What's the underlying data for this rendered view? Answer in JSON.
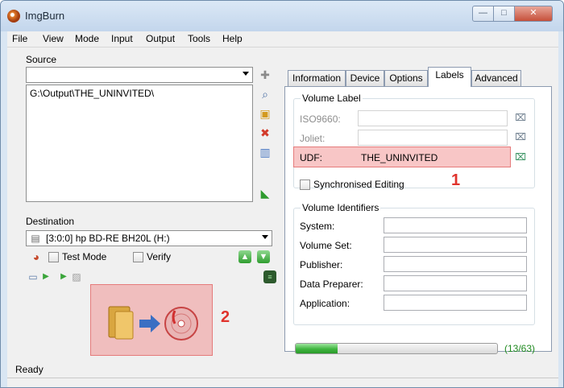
{
  "window": {
    "title": "ImgBurn",
    "minimize_symbol": "—",
    "maximize_symbol": "□",
    "close_symbol": "✕"
  },
  "menu": [
    "File",
    "View",
    "Mode",
    "Input",
    "Output",
    "Tools",
    "Help"
  ],
  "source": {
    "label": "Source",
    "combo_value": "",
    "list_items": [
      "G:\\Output\\THE_UNINVITED\\"
    ]
  },
  "destination": {
    "label": "Destination",
    "device": "[3:0:0] hp BD-RE  BH20L (H:)",
    "test_mode_label": "Test Mode",
    "test_mode_checked": false,
    "verify_label": "Verify",
    "verify_checked": false
  },
  "tabs": [
    "Information",
    "Device",
    "Options",
    "Labels",
    "Advanced"
  ],
  "active_tab": "Labels",
  "volume_label": {
    "title": "Volume Label",
    "iso9660_label": "ISO9660:",
    "iso9660_value": "",
    "joliet_label": "Joliet:",
    "joliet_value": "",
    "udf_label": "UDF:",
    "udf_value": "THE_UNINVITED",
    "sync_label": "Synchronised Editing",
    "sync_checked": false
  },
  "volume_identifiers": {
    "title": "Volume Identifiers",
    "fields": [
      {
        "label": "System:",
        "value": ""
      },
      {
        "label": "Volume Set:",
        "value": ""
      },
      {
        "label": "Publisher:",
        "value": ""
      },
      {
        "label": "Data Preparer:",
        "value": ""
      },
      {
        "label": "Application:",
        "value": ""
      }
    ]
  },
  "progress": {
    "fraction": 0.206,
    "text": "(13/63)"
  },
  "annotations": {
    "marker_1": "1",
    "marker_2": "2"
  },
  "status": {
    "text": "Ready"
  },
  "colors": {
    "highlight": "#f08080",
    "annotation": "#e0332c",
    "progress": "#3fb53f"
  },
  "icons": {
    "add": "add-icon",
    "search": "search-icon",
    "browse_folder": "browse-folder-icon",
    "delete": "delete-icon",
    "clear": "clear-icon",
    "build": "build-icon",
    "drive": "drive-icon",
    "eject": "eject-icon",
    "load": "load-icon",
    "log": "log-icon",
    "copy": "copy-icon",
    "lock": "lock-icon",
    "folder": "folder-icon",
    "arrow": "arrow-icon",
    "disc": "disc-icon"
  }
}
